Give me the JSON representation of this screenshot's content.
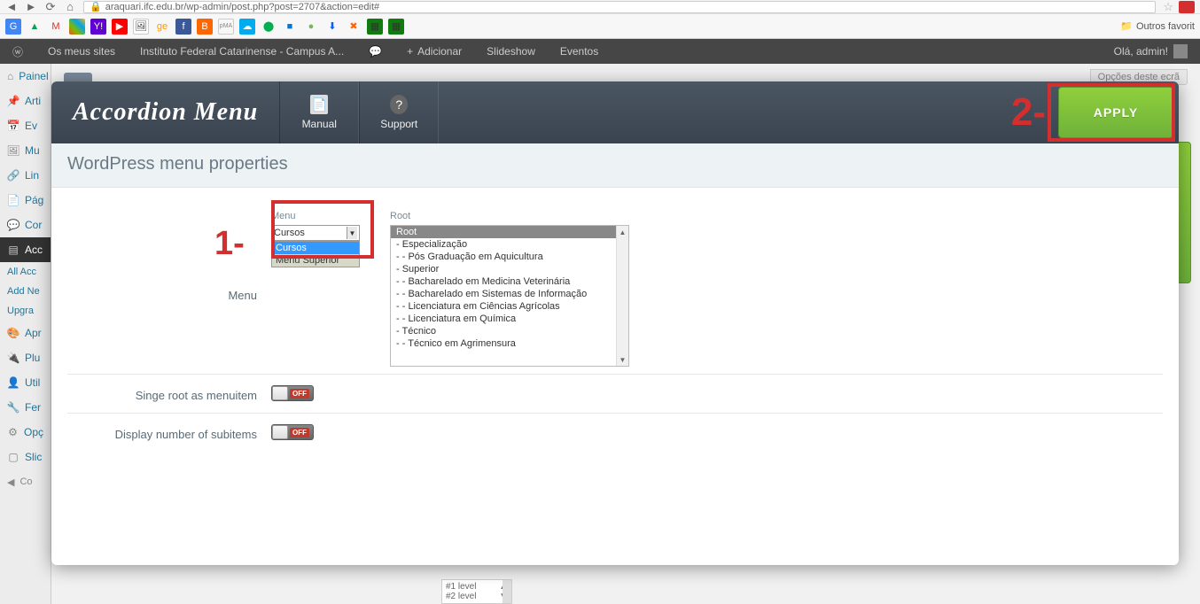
{
  "browser": {
    "url": "araquari.ifc.edu.br/wp-admin/post.php?post=2707&action=edit#",
    "bookmark_folder": "Outros favorit"
  },
  "wp_adminbar": {
    "my_sites": "Os meus sites",
    "site_name": "Instituto Federal Catarinense - Campus A...",
    "add_new": "Adicionar",
    "slideshow": "Slideshow",
    "events": "Eventos",
    "greeting": "Olá, admin!"
  },
  "wp_sidebar": {
    "painel": "Painel",
    "artigos": "Arti",
    "eventos": "Ev",
    "multimedia": "Mu",
    "links": "Lin",
    "paginas": "Pág",
    "comentarios": "Cor",
    "accordion": "Acc",
    "sub_all": "All Acc",
    "sub_add": "Add Ne",
    "sub_upgrade": "Upgra",
    "aparencia": "Apr",
    "plugins": "Plu",
    "utilizadores": "Util",
    "ferramentas": "Fer",
    "opcoes": "Opç",
    "slideshow2": "Slic",
    "collapse": "Co"
  },
  "wp_content": {
    "screen_options": "Opções deste ecrã",
    "level1": "#1 level",
    "level2": "#2 level"
  },
  "modal": {
    "title": "Accordion Menu",
    "tab_manual": "Manual",
    "tab_support": "Support",
    "apply": "APPLY",
    "section_title": "WordPress menu properties",
    "form": {
      "menu_label": "Menu",
      "col_menu": "Menu",
      "col_root": "Root",
      "select_value": "Cursos",
      "dropdown_items": [
        "Cursos",
        "Menu Superior"
      ],
      "root_items": [
        "Root",
        "- Especialização",
        "- - Pós Graduação em Aquicultura",
        "- Superior",
        "- - Bacharelado em Medicina Veterinária",
        "- - Bacharelado em Sistemas de Informação",
        "- - Licenciatura em Ciências Agrícolas",
        "- - Licenciatura em Química",
        "- Técnico",
        "- - Técnico em Agrimensura"
      ],
      "row_single_root": "Singe root as menuitem",
      "row_display_subitems": "Display number of subitems",
      "toggle_off": "OFF"
    }
  },
  "annotations": {
    "a1": "1-",
    "a2": "2-"
  }
}
